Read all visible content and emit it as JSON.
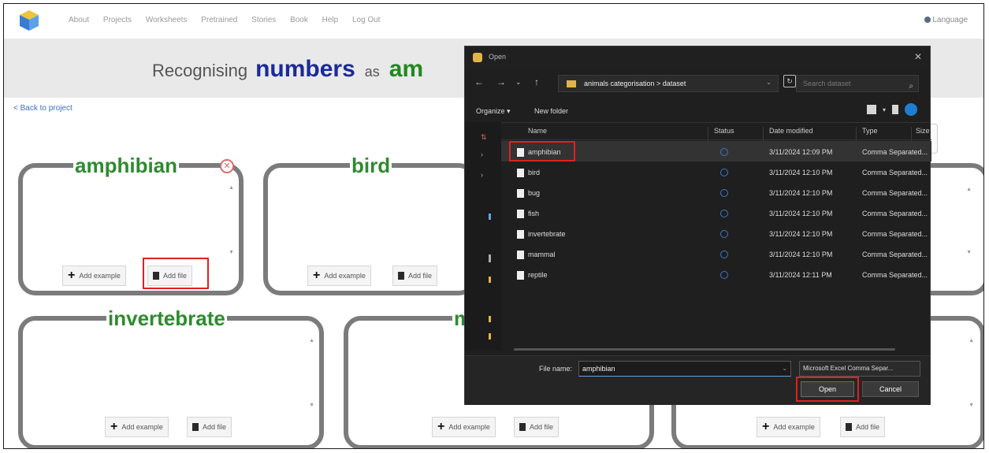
{
  "nav": {
    "links": [
      "About",
      "Projects",
      "Worksheets",
      "Pretrained",
      "Stories",
      "Book",
      "Help",
      "Log Out"
    ],
    "language": "Language"
  },
  "title": {
    "prefix": "Recognising",
    "subject": "numbers",
    "as": "as",
    "target": "am"
  },
  "back_link": "< Back to project",
  "buckets": [
    {
      "label": "amphibian",
      "add_example": "Add example",
      "add_file": "Add file"
    },
    {
      "label": "bird",
      "add_example": "Add example",
      "add_file": "Add file"
    },
    {
      "label": "invertebrate",
      "add_example": "Add example",
      "add_file": "Add file"
    },
    {
      "label": "m",
      "add_example": "Add example",
      "add_file": "Add file"
    },
    {
      "add_example": "Add example",
      "add_file": "Add file"
    }
  ],
  "dialog": {
    "title": "Open",
    "address": "animals categorisation  >  dataset",
    "search_placeholder": "Search dataset",
    "organize": "Organize ▾",
    "new_folder": "New folder",
    "columns": {
      "name": "Name",
      "status": "Status",
      "date": "Date modified",
      "type": "Type",
      "size": "Size"
    },
    "files": [
      {
        "name": "amphibian",
        "date": "3/11/2024 12:09 PM",
        "type": "Comma Separated..."
      },
      {
        "name": "bird",
        "date": "3/11/2024 12:10 PM",
        "type": "Comma Separated..."
      },
      {
        "name": "bug",
        "date": "3/11/2024 12:10 PM",
        "type": "Comma Separated..."
      },
      {
        "name": "fish",
        "date": "3/11/2024 12:10 PM",
        "type": "Comma Separated..."
      },
      {
        "name": "invertebrate",
        "date": "3/11/2024 12:10 PM",
        "type": "Comma Separated..."
      },
      {
        "name": "mammal",
        "date": "3/11/2024 12:10 PM",
        "type": "Comma Separated..."
      },
      {
        "name": "reptile",
        "date": "3/11/2024 12:11 PM",
        "type": "Comma Separated..."
      }
    ],
    "file_name_label": "File name:",
    "file_name_value": "amphibian",
    "file_type": "Microsoft Excel Comma Separ...",
    "open": "Open",
    "cancel": "Cancel"
  },
  "colors": {
    "label_green": "#2e8b2e",
    "title_blue": "#1a2a9a",
    "highlight_red": "#e02020",
    "dialog_bg": "#1f1f1f"
  }
}
